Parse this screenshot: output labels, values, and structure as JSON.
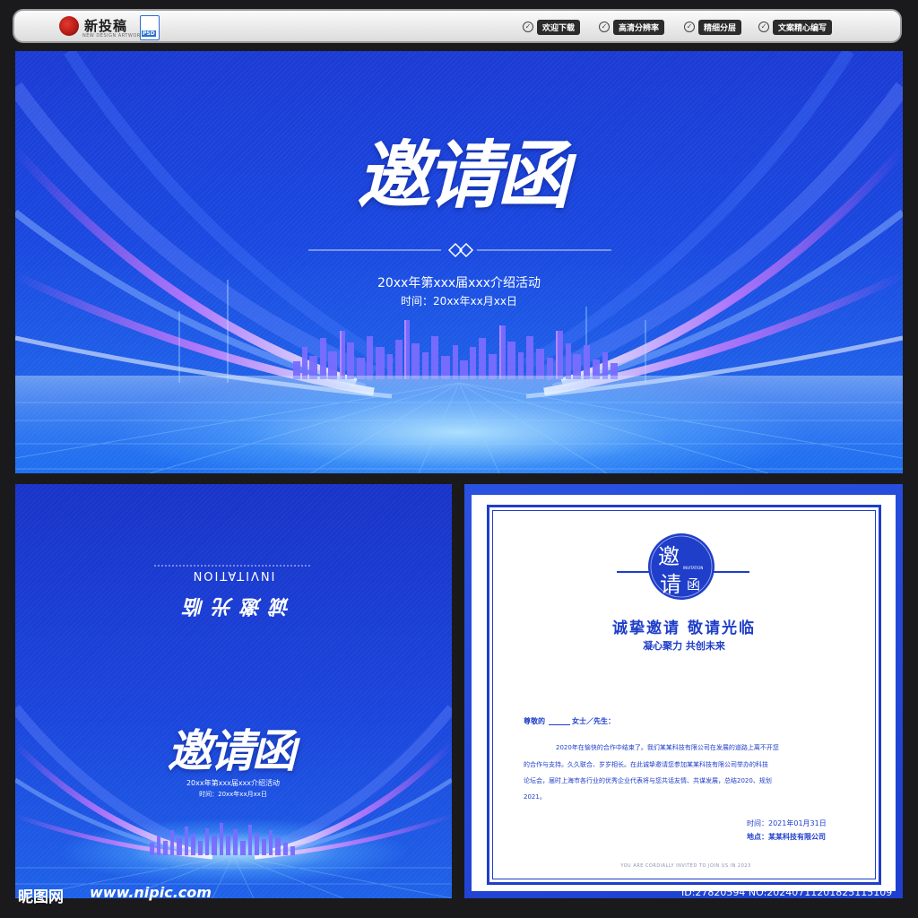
{
  "header": {
    "logo_text": "新投稿",
    "logo_sub": "NEW DESIGN ARTWORK",
    "file_badge": "PSD",
    "features": [
      "欢迎下载",
      "高清分辨率",
      "精细分层",
      "文案精心编写"
    ]
  },
  "top_panel": {
    "title": "邀请函",
    "event_line": "20xx年第xxx届xxx介绍活动",
    "time_line": "时间：20xx年xx月xx日"
  },
  "back_cover": {
    "invitation_en": "INVITATION",
    "slogan": "诚邀光临",
    "title": "邀请函",
    "event_line": "20xx年第xxx届xxx介绍活动",
    "time_line": "时间：20xx年xx月xx日"
  },
  "letter": {
    "seal_char1": "邀",
    "seal_char2": "请",
    "seal_char3": "函",
    "seal_en": "INVITATION",
    "headline": "诚挚邀请  敬请光临",
    "subline": "凝心聚力 共创未来",
    "salutation_prefix": "尊敬的",
    "salutation_suffix": "女士／先生：",
    "body1": "2020年在愉快的合作中结束了。我们某某科技有限公司在发展的道路上离不开您",
    "body2": "的合作与支持。久久联合、岁岁相长。在此诚挚邀请您参加某某科技有限公司举办的科技",
    "body3": "论坛会，届时上海市各行业的优秀企业代表将与您共话友情、共谋发展，总结2020、规划",
    "body4": "2021。",
    "date_line": "时间：2021年01月31日",
    "place_line": "地点：某某科技有限公司",
    "footer_en": "YOU ARE CORDIALLY INVITED TO JOIN US IN 2023"
  },
  "watermark": {
    "site_name": "昵图网",
    "url": "www.nipic.com",
    "id_line": "ID:27820594 NO:20240711201825115109"
  },
  "colors": {
    "brand_blue": "#1f3ec9",
    "bg_dark": "#1a1a1d"
  }
}
